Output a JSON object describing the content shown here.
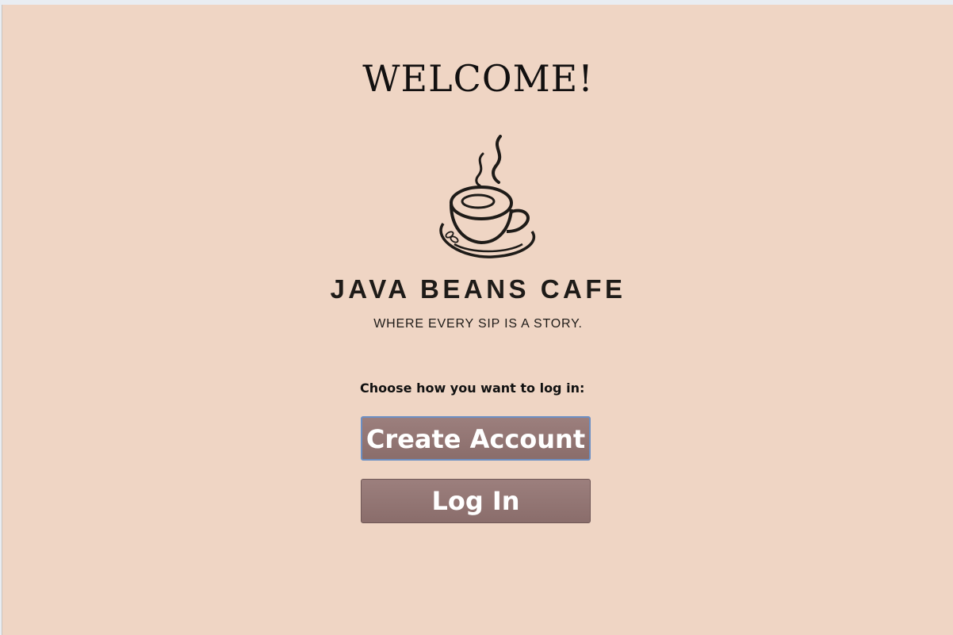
{
  "welcome_title": "WELCOME!",
  "logo": {
    "icon": "coffee-cup-icon",
    "brand_name": "JAVA BEANS CAFE",
    "tagline": "WHERE EVERY SIP IS A STORY."
  },
  "login_prompt": "Choose how you want to log in:",
  "buttons": {
    "create_account": "Create Account",
    "log_in": "Log In"
  },
  "colors": {
    "background": "#efd5c4",
    "button": "#957876",
    "focus_border": "#6c8fc4"
  }
}
